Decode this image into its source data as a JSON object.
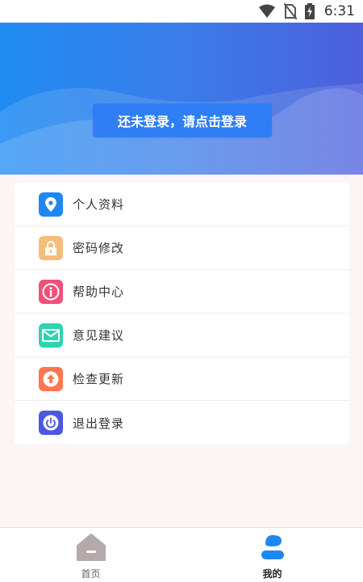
{
  "status_bar": {
    "time": "6:31"
  },
  "header": {
    "login_prompt": "还未登录，请点击登录"
  },
  "menu": {
    "items": [
      {
        "label": "个人资料",
        "icon": "location-pin-icon",
        "color": "#1e88f0"
      },
      {
        "label": "密码修改",
        "icon": "lock-icon",
        "color": "#f5bd7b"
      },
      {
        "label": "帮助中心",
        "icon": "info-icon",
        "color": "#f0517a"
      },
      {
        "label": "意见建议",
        "icon": "mail-icon",
        "color": "#2dd4b0"
      },
      {
        "label": "检查更新",
        "icon": "upload-arrow-icon",
        "color": "#ff7650"
      },
      {
        "label": "退出登录",
        "icon": "power-icon",
        "color": "#4a57e0"
      }
    ]
  },
  "tabs": [
    {
      "label": "首页",
      "icon": "home-icon",
      "active": false
    },
    {
      "label": "我的",
      "icon": "user-icon",
      "active": true
    }
  ],
  "colors": {
    "header_gradient_start": "#1f8cf3",
    "header_gradient_end": "#4d5fdc",
    "accent": "#2f7ef5"
  }
}
